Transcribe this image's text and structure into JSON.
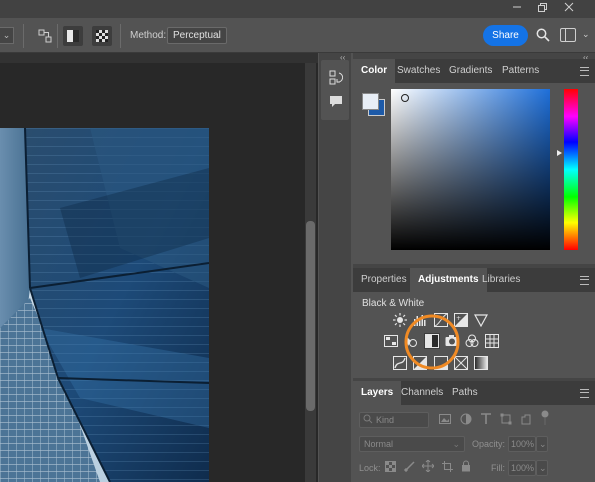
{
  "window": {
    "minimize_icon": "minimize-icon",
    "maximize_icon": "restore-icon",
    "close_icon": "close-icon"
  },
  "options_bar": {
    "method_label": "Method:",
    "method_value": "Perceptual",
    "share_label": "Share"
  },
  "panels_collapse": "‹‹",
  "color_panel": {
    "tabs": [
      "Color",
      "Swatches",
      "Gradients",
      "Patterns"
    ],
    "active_tab": "Color",
    "foreground_color": "#e8eef6",
    "background_color": "#1d5aa8",
    "hue_color": "#1e6fd9"
  },
  "adjustments_panel": {
    "tabs": [
      "Properties",
      "Adjustments",
      "Libraries"
    ],
    "active_tab": "Adjustments",
    "hover_label": "Black & White",
    "highlight_color": "#f08a24"
  },
  "layers_panel": {
    "tabs": [
      "Layers",
      "Channels",
      "Paths"
    ],
    "active_tab": "Layers",
    "kind_placeholder": "Kind",
    "blend_mode": "Normal",
    "opacity_label": "Opacity:",
    "opacity_value": "100%",
    "lock_label": "Lock:",
    "fill_label": "Fill:",
    "fill_value": "100%"
  }
}
